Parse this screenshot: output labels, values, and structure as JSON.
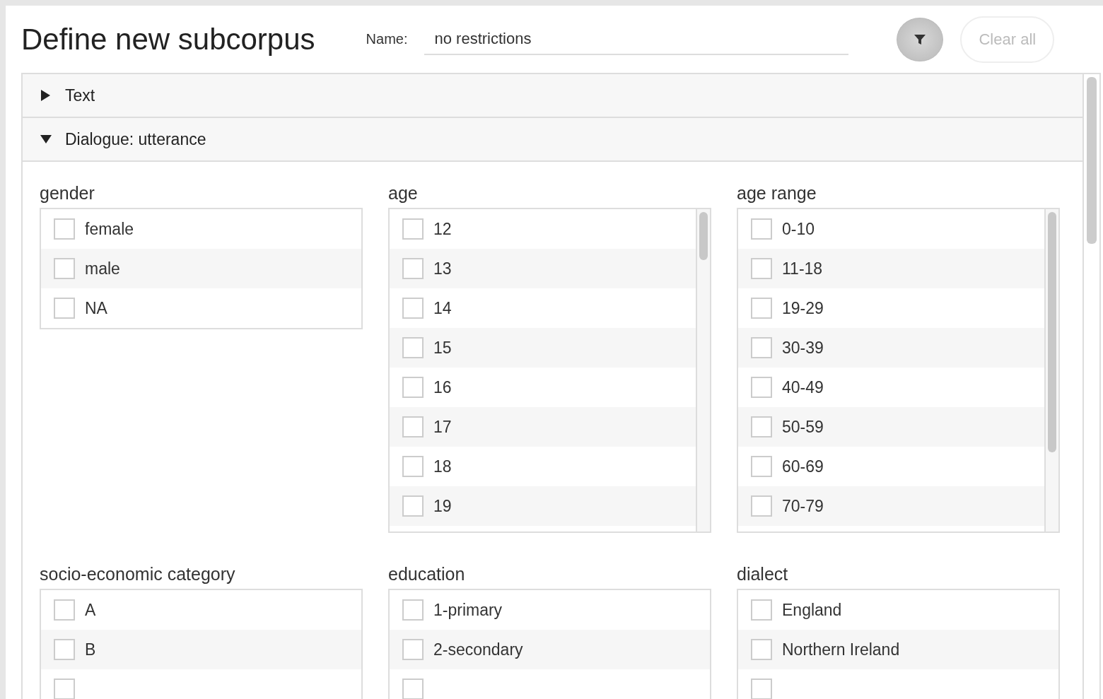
{
  "title": "Define new subcorpus",
  "name_field": {
    "label": "Name:",
    "value": "no restrictions"
  },
  "clear_button": {
    "label": "Clear all",
    "disabled": true
  },
  "sections": [
    {
      "label": "Text",
      "expanded": false
    },
    {
      "label": "Dialogue: utterance",
      "expanded": true,
      "groups": [
        {
          "label": "gender",
          "scrollbar": false,
          "items": [
            {
              "label": "female",
              "checked": false
            },
            {
              "label": "male",
              "checked": false
            },
            {
              "label": "NA",
              "checked": false
            }
          ]
        },
        {
          "label": "age",
          "scrollbar": true,
          "items": [
            {
              "label": "12",
              "checked": false
            },
            {
              "label": "13",
              "checked": false
            },
            {
              "label": "14",
              "checked": false
            },
            {
              "label": "15",
              "checked": false
            },
            {
              "label": "16",
              "checked": false
            },
            {
              "label": "17",
              "checked": false
            },
            {
              "label": "18",
              "checked": false
            },
            {
              "label": "19",
              "checked": false
            }
          ]
        },
        {
          "label": "age range",
          "scrollbar": true,
          "items": [
            {
              "label": "0-10",
              "checked": false
            },
            {
              "label": "11-18",
              "checked": false
            },
            {
              "label": "19-29",
              "checked": false
            },
            {
              "label": "30-39",
              "checked": false
            },
            {
              "label": "40-49",
              "checked": false
            },
            {
              "label": "50-59",
              "checked": false
            },
            {
              "label": "60-69",
              "checked": false
            },
            {
              "label": "70-79",
              "checked": false
            }
          ]
        },
        {
          "label": "socio-economic category",
          "scrollbar": false,
          "items": [
            {
              "label": "A",
              "checked": false
            },
            {
              "label": "B",
              "checked": false
            }
          ]
        },
        {
          "label": "education",
          "scrollbar": false,
          "items": [
            {
              "label": "1-primary",
              "checked": false
            },
            {
              "label": "2-secondary",
              "checked": false
            }
          ]
        },
        {
          "label": "dialect",
          "scrollbar": false,
          "items": [
            {
              "label": "England",
              "checked": false
            },
            {
              "label": "Northern Ireland",
              "checked": false
            }
          ]
        }
      ]
    }
  ]
}
